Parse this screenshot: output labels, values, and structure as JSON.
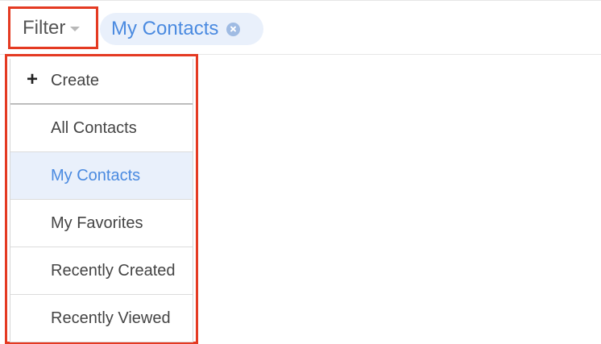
{
  "filter": {
    "label": "Filter",
    "caret_icon": "caret-down-icon",
    "active_filter": "My Contacts",
    "remove_icon": "remove-circle-icon"
  },
  "dropdown": {
    "create": {
      "icon": "plus-icon",
      "icon_glyph": "+",
      "label": "Create"
    },
    "items": [
      {
        "label": "All Contacts",
        "selected": false
      },
      {
        "label": "My Contacts",
        "selected": true
      },
      {
        "label": "My Favorites",
        "selected": false
      },
      {
        "label": "Recently Created",
        "selected": false
      },
      {
        "label": "Recently Viewed",
        "selected": false
      }
    ]
  },
  "colors": {
    "highlight_border": "#e43a22",
    "accent_blue": "#4a8ae0",
    "selected_bg": "#e9f0fb"
  }
}
